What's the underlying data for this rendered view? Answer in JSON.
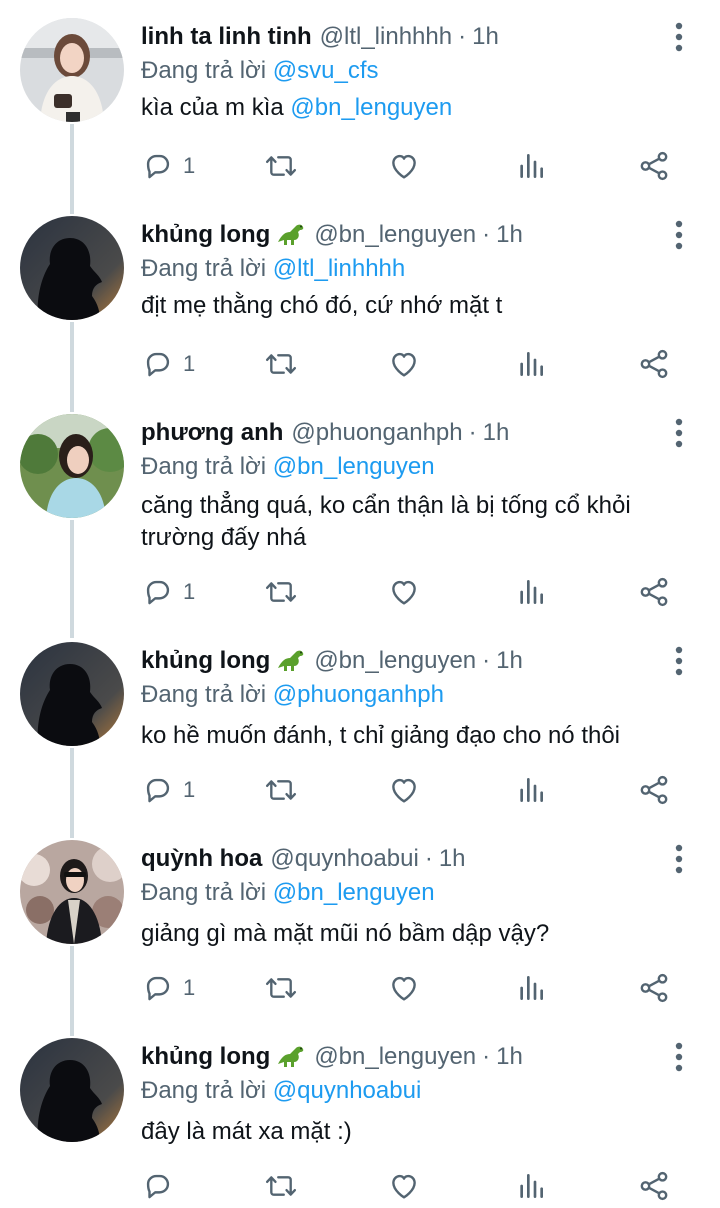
{
  "colors": {
    "link": "#1d9bf0",
    "secondary_text": "#536471",
    "primary_text": "#0f1419",
    "thread_line": "#cfd9de"
  },
  "replies": [
    {
      "name": "linh ta linh tinh",
      "emoji": "",
      "handle": "@ltl_linhhhh",
      "dot": "·",
      "time": "1h",
      "replying_label": "Đang trả lời",
      "replying_to": "@svu_cfs",
      "text_before": "kìa của m kìa ",
      "text_mention": "@bn_lenguyen",
      "reply_count": "1",
      "avatar_icon": "avatar-girl-light"
    },
    {
      "name": "khủng long",
      "emoji": "dinosaur-emoji",
      "handle": "@bn_lenguyen",
      "dot": "·",
      "time": "1h",
      "replying_label": "Đang trả lời",
      "replying_to": "@ltl_linhhhh",
      "text_before": "địt mẹ thằng chó đó, cứ nhớ mặt t",
      "text_mention": "",
      "reply_count": "1",
      "avatar_icon": "avatar-silhouette"
    },
    {
      "name": "phương anh",
      "emoji": "",
      "handle": "@phuonganhph",
      "dot": "·",
      "time": "1h",
      "replying_label": "Đang trả lời",
      "replying_to": "@bn_lenguyen",
      "text_before": "căng thẳng quá, ko cẩn thận là bị tống cổ khỏi trường đấy nhá",
      "text_mention": "",
      "reply_count": "1",
      "avatar_icon": "avatar-girl-outdoor"
    },
    {
      "name": "khủng long",
      "emoji": "dinosaur-emoji",
      "handle": "@bn_lenguyen",
      "dot": "·",
      "time": "1h",
      "replying_label": "Đang trả lời",
      "replying_to": "@phuonganhph",
      "text_before": "ko hề muốn đánh, t chỉ giảng đạo cho nó thôi",
      "text_mention": "",
      "reply_count": "1",
      "avatar_icon": "avatar-silhouette"
    },
    {
      "name": "quỳnh hoa",
      "emoji": "",
      "handle": "@quynhoabui",
      "dot": "·",
      "time": "1h",
      "replying_label": "Đang trả lời",
      "replying_to": "@bn_lenguyen",
      "text_before": "giảng gì mà mặt mũi nó bầm dập vậy?",
      "text_mention": "",
      "reply_count": "1",
      "avatar_icon": "avatar-girl-blossom"
    },
    {
      "name": "khủng long",
      "emoji": "dinosaur-emoji",
      "handle": "@bn_lenguyen",
      "dot": "·",
      "time": "1h",
      "replying_label": "Đang trả lời",
      "replying_to": "@quynhoabui",
      "text_before": "đây là mát xa mặt :)",
      "text_mention": "",
      "reply_count": "",
      "avatar_icon": "avatar-silhouette"
    }
  ]
}
